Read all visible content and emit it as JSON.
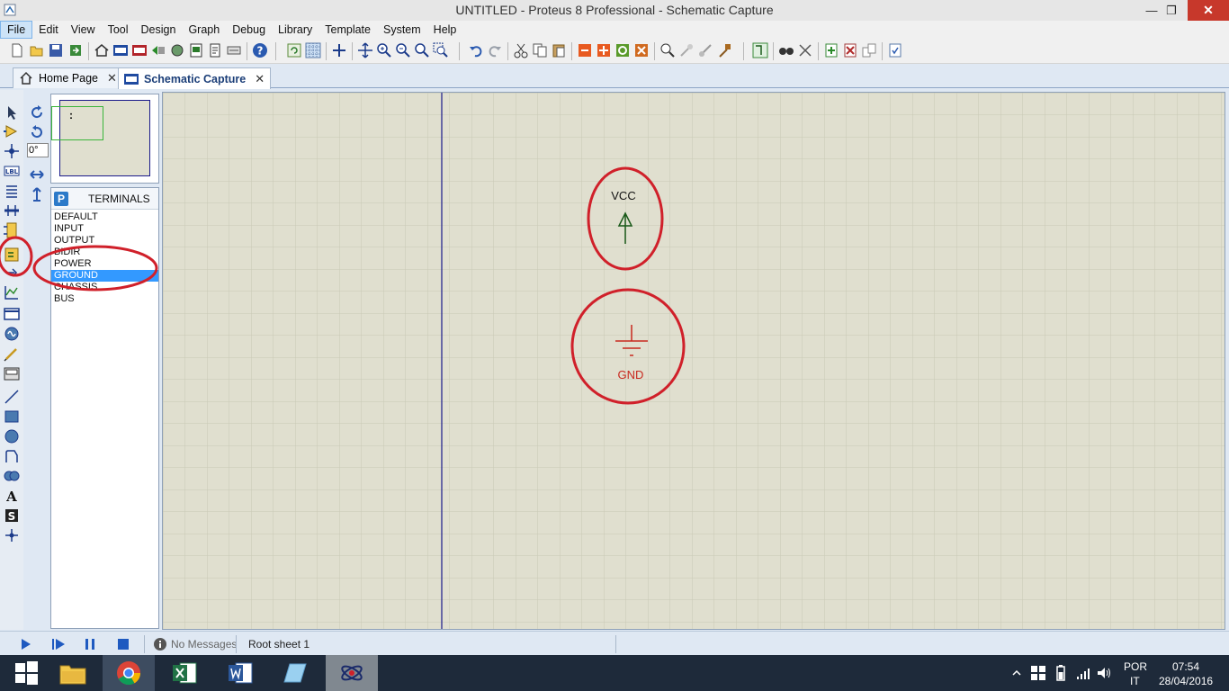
{
  "window": {
    "title": "UNTITLED - Proteus 8 Professional - Schematic Capture",
    "minimize": "—",
    "maximize": "❐",
    "close": "✕"
  },
  "menu": [
    "File",
    "Edit",
    "View",
    "Tool",
    "Design",
    "Graph",
    "Debug",
    "Library",
    "Template",
    "System",
    "Help"
  ],
  "tabs": [
    {
      "label": "Home Page",
      "close": "✕"
    },
    {
      "label": "Schematic Capture",
      "close": "✕"
    }
  ],
  "rotation": {
    "value": "0°"
  },
  "overview": {
    "marker": ":"
  },
  "selector": {
    "button": "P",
    "title": "TERMINALS",
    "items": [
      "DEFAULT",
      "INPUT",
      "OUTPUT",
      "BIDIR",
      "POWER",
      "GROUND",
      "CHASSIS",
      "BUS"
    ],
    "selected": "GROUND"
  },
  "schematic": {
    "vcc_label": "VCC",
    "gnd_label": "GND"
  },
  "status": {
    "messages": "No Messages",
    "sheet": "Root sheet 1"
  },
  "tray": {
    "lang_top": "POR",
    "lang_bottom": "IT",
    "time": "07:54",
    "date": "28/04/2016"
  },
  "colors": {
    "annotation": "#d0202a",
    "grid_bg": "#e0dfcf",
    "vcc_arrow": "#1a5a1a",
    "gnd": "#c8281e",
    "selection": "#3399ff"
  }
}
